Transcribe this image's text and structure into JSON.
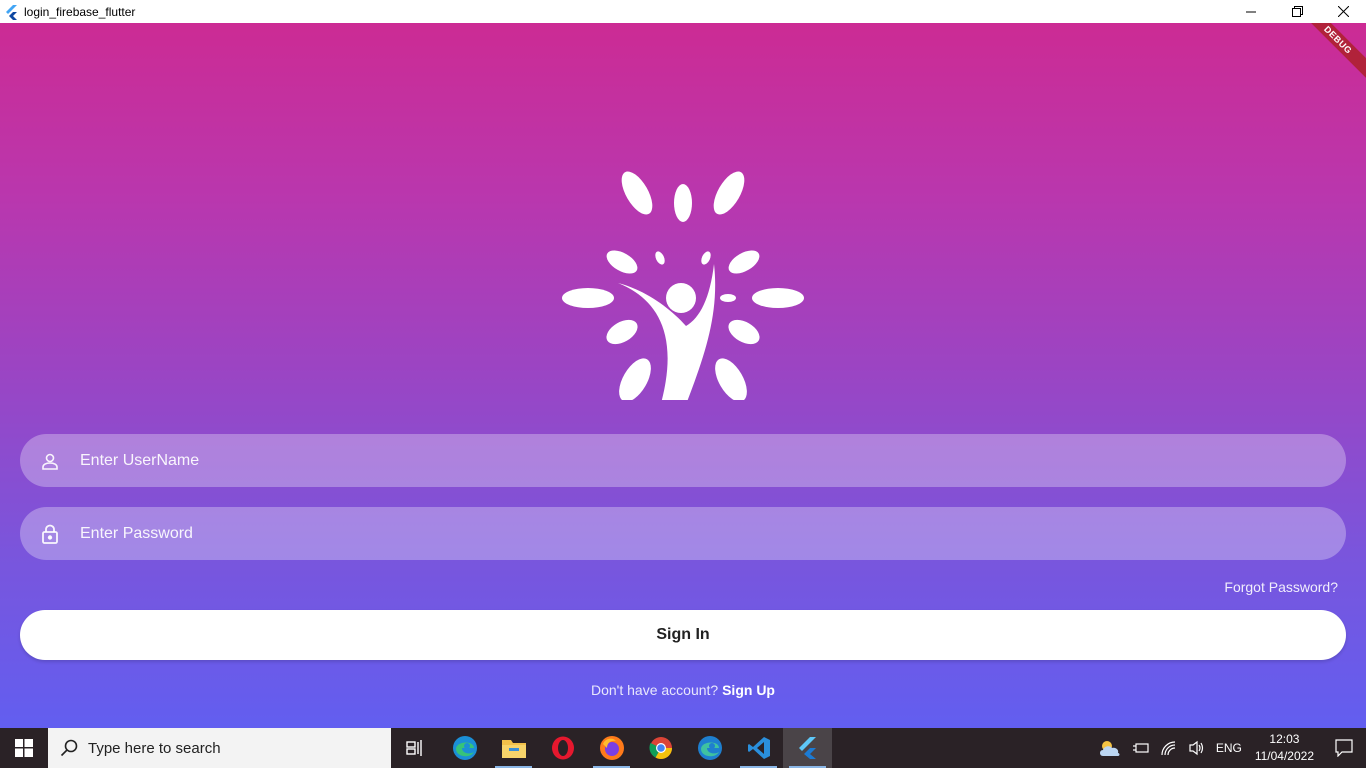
{
  "window": {
    "title": "login_firebase_flutter"
  },
  "app": {
    "debug_label": "DEBUG",
    "username_placeholder": "Enter UserName",
    "password_placeholder": "Enter Password",
    "forgot_password": "Forgot Password?",
    "signin_label": "Sign In",
    "no_account_text": "Don't have account?",
    "signup_label": "Sign Up",
    "colors": {
      "gradient_top": "#cc2b94",
      "gradient_bottom": "#625ef0",
      "debug_banner": "#b1223a"
    }
  },
  "taskbar": {
    "search_placeholder": "Type here to search",
    "pinned_icons": [
      "task-view-icon",
      "edge-icon",
      "file-explorer-icon",
      "opera-icon",
      "firefox-icon",
      "chrome-icon",
      "edge-dev-icon",
      "vscode-icon",
      "flutter-icon"
    ],
    "language": "ENG",
    "time": "12:03",
    "date": "11/04/2022"
  }
}
